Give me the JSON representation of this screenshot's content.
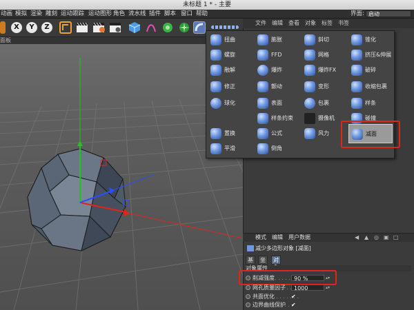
{
  "window": {
    "title": "未标题 1 * - 主要"
  },
  "menu": {
    "items": [
      "动画",
      "模拟",
      "渲染",
      "雕刻",
      "运动跟踪",
      "运动图形",
      "角色",
      "流水线",
      "插件",
      "脚本",
      "窗口",
      "帮助"
    ],
    "layout_label": "界面:",
    "layout_value": "启动"
  },
  "toolbar": {
    "axis_x": "X",
    "axis_y": "Y",
    "axis_z": "Z"
  },
  "viewport": {
    "panel_label": "面板"
  },
  "right_panel": {
    "menu": [
      "文件",
      "编辑",
      "查看",
      "对象",
      "标签",
      "书签"
    ]
  },
  "deformer_menu": {
    "col1": [
      "扭曲",
      "螺旋",
      "融解",
      "修正",
      "球化",
      "置换",
      "平滑"
    ],
    "col2": [
      "膨胀",
      "FFD",
      "爆炸",
      "颤动",
      "表面",
      "样条约束",
      "公式",
      "倒角"
    ],
    "col3": [
      "斜切",
      "网格",
      "爆炸FX",
      "变形",
      "包裹",
      "摄像机",
      "风力"
    ],
    "col4": [
      "锥化",
      "挤压&伸展",
      "破碎",
      "收缩包裹",
      "样条",
      "碰撞",
      "减面"
    ],
    "selected": "减面"
  },
  "attributes": {
    "menu": [
      "模式",
      "编辑",
      "用户数据"
    ],
    "object_title": "减少多边形对象 [减面]",
    "tabs": [
      "基本",
      "坐标",
      "对象"
    ],
    "active_tab": "对象",
    "section": "对象属性",
    "rows": [
      {
        "label": "削减强度",
        "dots": ". . . . . .",
        "value": "90 %"
      },
      {
        "label": "网孔质量因子",
        "dots": ". . .",
        "value": "1000"
      },
      {
        "label": "共面优化",
        "dots": ". . . . . . .",
        "value": "✔"
      },
      {
        "label": "边界曲线保护",
        "dots": ". . .",
        "value": "✔"
      }
    ]
  },
  "colors": {
    "highlight_red": "#e0261b",
    "axis_x": "#e0261b",
    "axis_y": "#1fc41f",
    "axis_z": "#2c4cff"
  }
}
